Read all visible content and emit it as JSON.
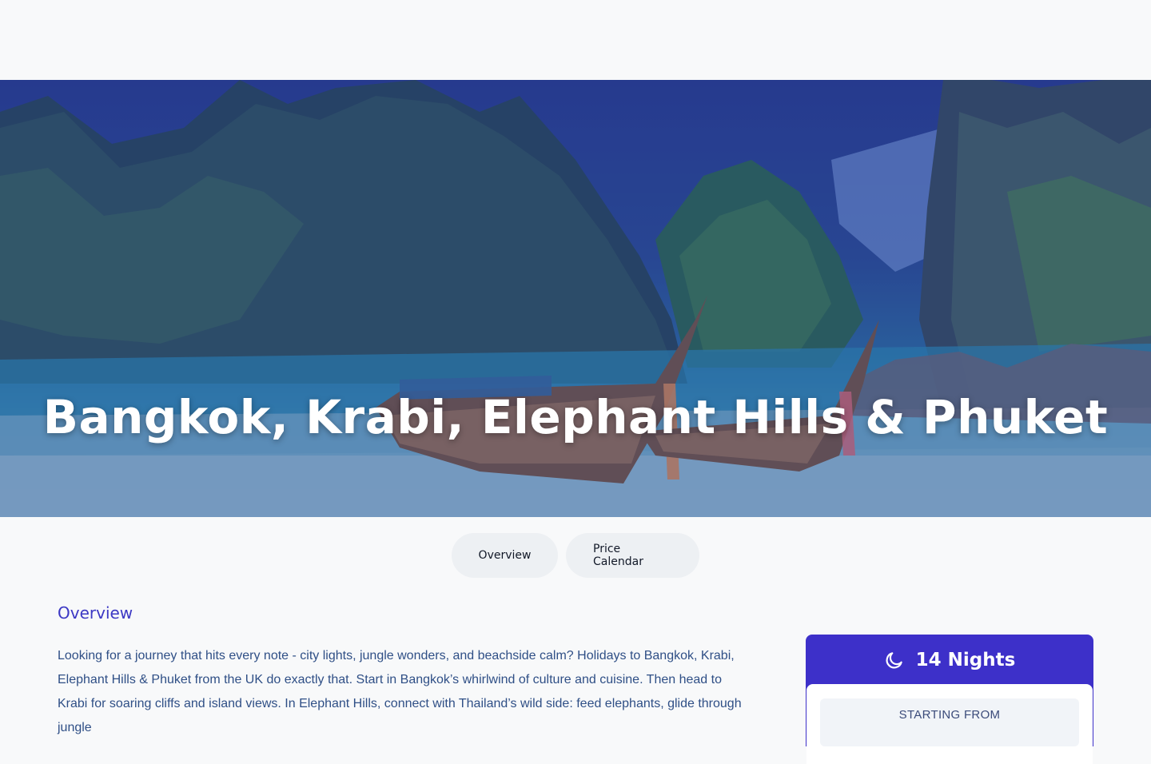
{
  "hero": {
    "title": "Bangkok, Krabi, Elephant Hills & Phuket",
    "slide_count": 3,
    "active_slide": 1,
    "image_icon": "tropical-beach-longtail-boats"
  },
  "tabs": [
    {
      "label": "Overview"
    },
    {
      "label": "Price Calendar"
    }
  ],
  "overview": {
    "heading": "Overview",
    "text": "Looking for a journey that hits every note - city lights, jungle wonders, and beachside calm? Holidays to Bangkok, Krabi, Elephant Hills & Phuket from the UK do exactly that. Start in Bangkok’s whirlwind of culture and cuisine. Then head to Krabi for soaring cliffs and island views. In Elephant Hills, connect with Thailand’s wild side: feed elephants, glide through jungle"
  },
  "summary_card": {
    "icon": "moon-icon",
    "nights": "14 Nights",
    "starting_from": "STARTING FROM"
  },
  "colors": {
    "accent": "#3d30c9",
    "heading": "#3c38c4",
    "body_text": "#2f4f86",
    "active_dot": "#1e88ff"
  }
}
